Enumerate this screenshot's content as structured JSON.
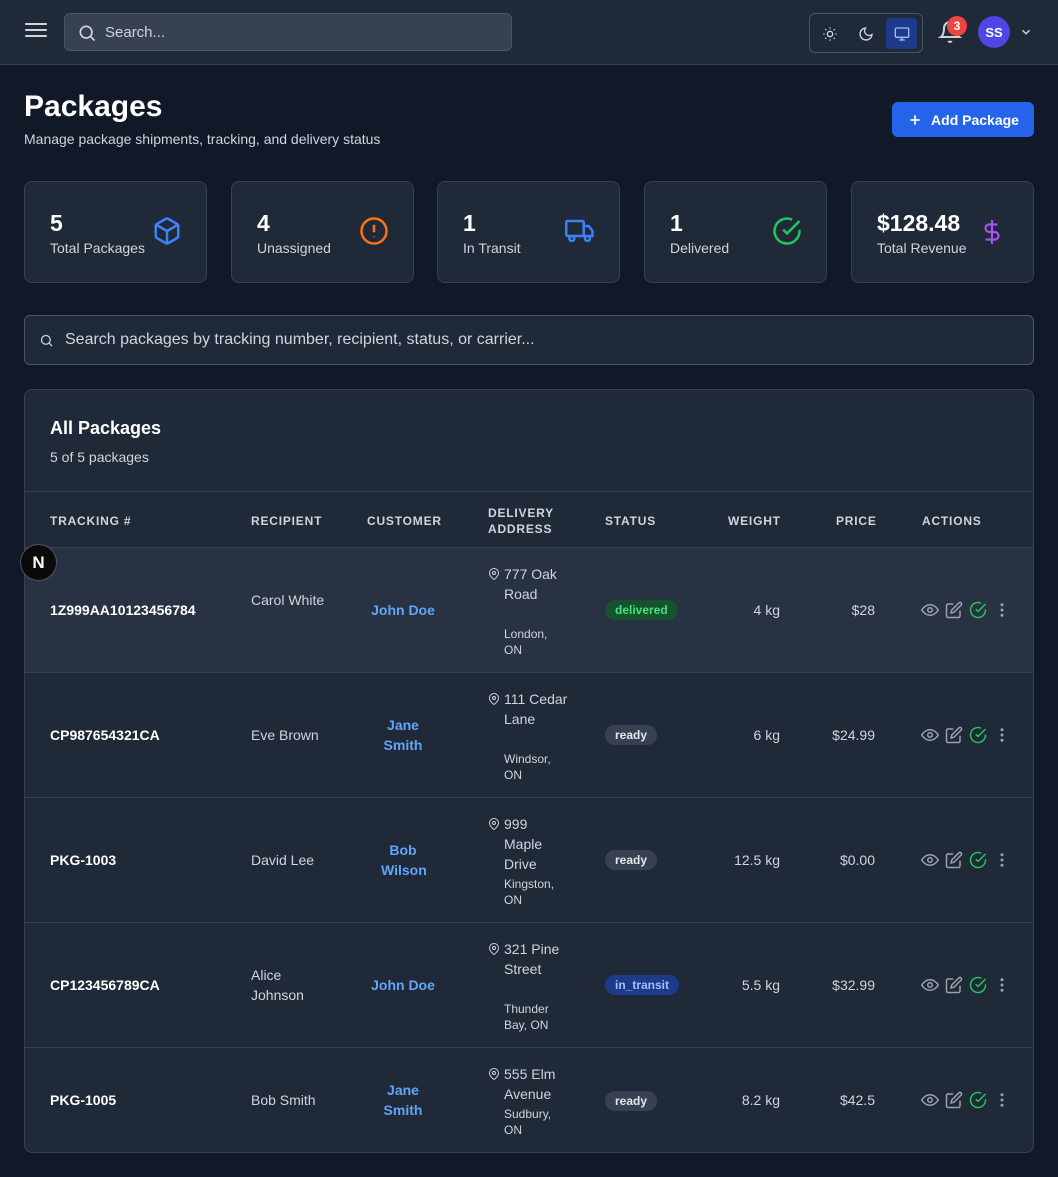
{
  "topbar": {
    "search_placeholder": "Search...",
    "notification_count": "3",
    "avatar_initials": "SS",
    "theme_options": [
      "light",
      "dark",
      "system"
    ],
    "active_theme": "system"
  },
  "header": {
    "title": "Packages",
    "subtitle": "Manage package shipments, tracking, and delivery status",
    "add_button_label": "Add Package"
  },
  "stats": [
    {
      "value": "5",
      "label": "Total Packages",
      "icon": "package-icon",
      "color": "#3b82f6"
    },
    {
      "value": "4",
      "label": "Unassigned",
      "icon": "alert-circle-icon",
      "color": "#f97316"
    },
    {
      "value": "1",
      "label": "In Transit",
      "icon": "truck-icon",
      "color": "#3b82f6"
    },
    {
      "value": "1",
      "label": "Delivered",
      "icon": "check-circle-icon",
      "color": "#22c55e"
    },
    {
      "value": "$128.48",
      "label": "Total Revenue",
      "icon": "dollar-icon",
      "color": "#a855f7"
    }
  ],
  "package_search": {
    "placeholder": "Search packages by tracking number, recipient, status, or carrier..."
  },
  "table": {
    "title": "All Packages",
    "count_text": "5 of 5 packages",
    "columns": [
      "TRACKING #",
      "RECIPIENT",
      "CUSTOMER",
      "DELIVERY ADDRESS",
      "STATUS",
      "WEIGHT",
      "PRICE",
      "ACTIONS"
    ],
    "rows": [
      {
        "tracking": "1Z999AA10123456784",
        "recipient": "Carol White",
        "customer": "John Doe",
        "street": "777 Oak Road",
        "city": "London, ON",
        "status": "delivered",
        "weight": "4 kg",
        "price": "$28"
      },
      {
        "tracking": "CP987654321CA",
        "recipient": "Eve Brown",
        "customer": "Jane Smith",
        "street": "111 Cedar Lane",
        "city": "Windsor, ON",
        "status": "ready",
        "weight": "6 kg",
        "price": "$24.99"
      },
      {
        "tracking": "PKG-1003",
        "recipient": "David Lee",
        "customer": "Bob Wilson",
        "street": "999 Maple Drive",
        "city": "Kingston, ON",
        "status": "ready",
        "weight": "12.5 kg",
        "price": "$0.00"
      },
      {
        "tracking": "CP123456789CA",
        "recipient": "Alice Johnson",
        "customer": "John Doe",
        "street": "321 Pine Street",
        "city": "Thunder Bay, ON",
        "status": "in_transit",
        "weight": "5.5 kg",
        "price": "$32.99"
      },
      {
        "tracking": "PKG-1005",
        "recipient": "Bob Smith",
        "customer": "Jane Smith",
        "street": "555 Elm Avenue",
        "city": "Sudbury, ON",
        "status": "ready",
        "weight": "8.2 kg",
        "price": "$42.5"
      }
    ]
  },
  "colors": {
    "accent": "#2563eb",
    "link": "#60a5fa",
    "background": "#111827",
    "surface": "#1f2937"
  },
  "dev_badge": "N"
}
